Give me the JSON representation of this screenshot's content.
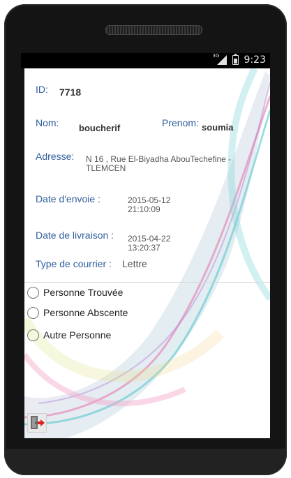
{
  "status_bar": {
    "network": "3G",
    "time": "9:23"
  },
  "form": {
    "id_label": "ID:",
    "id_value": "7718",
    "nom_label": "Nom:",
    "nom_value": "boucherif",
    "prenom_label": "Prenom:",
    "prenom_value": "soumia",
    "adresse_label": "Adresse:",
    "adresse_line1": "N 16 , Rue El-Biyadha AbouTechefine -",
    "adresse_line2": "TLEMCEN",
    "date_envoi_label": "Date d'envoie :",
    "date_envoi_date": "2015-05-12",
    "date_envoi_time": "21:10:09",
    "date_livraison_label": "Date de livraison :",
    "date_livraison_date": "2015-04-22",
    "date_livraison_time": "13:20:37",
    "type_label": "Type de courrier :",
    "type_value": "Lettre"
  },
  "options": [
    {
      "label": "Personne Trouvée",
      "selected": false
    },
    {
      "label": "Personne Abscente",
      "selected": false
    },
    {
      "label": "Autre Personne",
      "selected": false
    }
  ],
  "icons": {
    "exit": "exit-door-icon",
    "battery": "battery-icon",
    "signal": "signal-icon"
  }
}
